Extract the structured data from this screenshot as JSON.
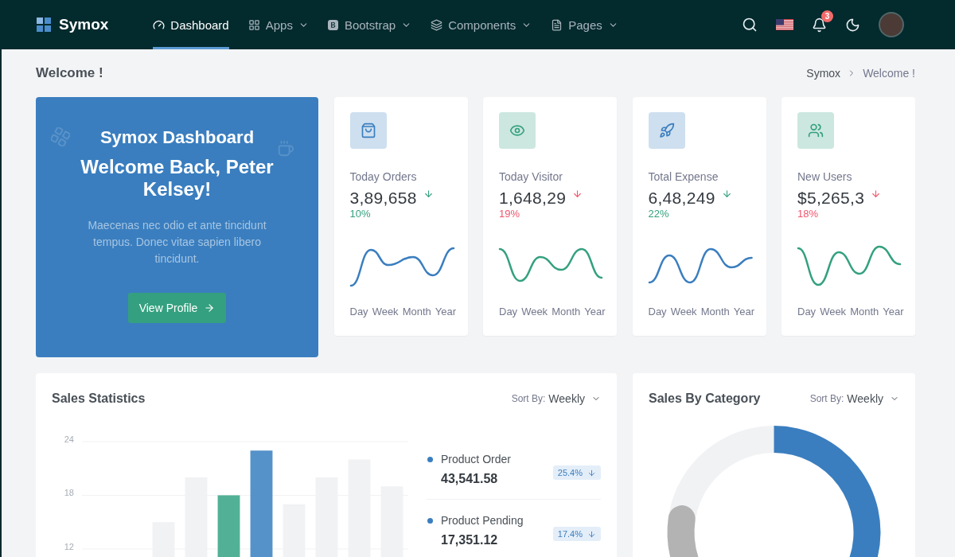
{
  "header": {
    "brand": "Symox",
    "nav": [
      {
        "label": "Dashboard",
        "selected": true,
        "dropdown": false
      },
      {
        "label": "Apps",
        "selected": false,
        "dropdown": true
      },
      {
        "label": "Bootstrap",
        "selected": false,
        "dropdown": true
      },
      {
        "label": "Components",
        "selected": false,
        "dropdown": true
      },
      {
        "label": "Pages",
        "selected": false,
        "dropdown": true
      }
    ],
    "notification_count": "3"
  },
  "page": {
    "title": "Welcome !",
    "breadcrumb": [
      {
        "label": "Symox",
        "current": false
      },
      {
        "label": "Welcome !",
        "current": true
      }
    ]
  },
  "welcome_card": {
    "title": "Symox Dashboard",
    "greeting": "Welcome Back, Peter Kelsey!",
    "text": "Maecenas nec odio et ante tincidunt tempus. Donec vitae sapien libero tincidunt.",
    "button": "View Profile"
  },
  "stats": [
    {
      "label": "Today Orders",
      "value": "3,89,658",
      "down": true,
      "positive": true,
      "change": "10%",
      "color": "#3a7ebf",
      "periods": [
        "Day",
        "Week",
        "Month",
        "Year"
      ]
    },
    {
      "label": "Today Visitor",
      "value": "1,648,29",
      "down": true,
      "positive": false,
      "change": "19%",
      "color": "#34a07f",
      "periods": [
        "Day",
        "Week",
        "Month",
        "Year"
      ]
    },
    {
      "label": "Total Expense",
      "value": "6,48,249",
      "down": true,
      "positive": true,
      "change": "22%",
      "color": "#3a7ebf",
      "periods": [
        "Day",
        "Week",
        "Month",
        "Year"
      ]
    },
    {
      "label": "New Users",
      "value": "$5,265,3",
      "down": true,
      "positive": false,
      "change": "18%",
      "color": "#34a07f",
      "periods": [
        "Day",
        "Week",
        "Month",
        "Year"
      ]
    }
  ],
  "sales_statistics": {
    "title": "Sales Statistics",
    "sort_label": "Sort By:",
    "sort_value": "Weekly",
    "chart_data": {
      "type": "bar",
      "stacked": true,
      "grid": true,
      "ylim": [
        11.1,
        24
      ],
      "yticks": [
        12,
        18,
        24
      ],
      "series": [
        {
          "color": "#f1f2f4",
          "values": [
            null,
            null,
            15,
            20,
            null,
            null,
            17,
            20,
            22,
            19
          ]
        },
        {
          "color": "#52b096",
          "values": [
            null,
            null,
            null,
            null,
            18,
            null,
            null,
            null,
            null,
            null
          ]
        },
        {
          "color": "#5592ca",
          "values": [
            null,
            null,
            null,
            null,
            null,
            23,
            null,
            null,
            null,
            null
          ]
        }
      ]
    },
    "legend": [
      {
        "name": "Product Order",
        "value": "43,541.58",
        "change": "25.4%",
        "down": true
      },
      {
        "name": "Product Pending",
        "value": "17,351.12",
        "change": "17.4%",
        "down": true
      }
    ]
  },
  "sales_by_category": {
    "title": "Sales By Category",
    "sort_label": "Sort By:",
    "sort_value": "Weekly"
  }
}
